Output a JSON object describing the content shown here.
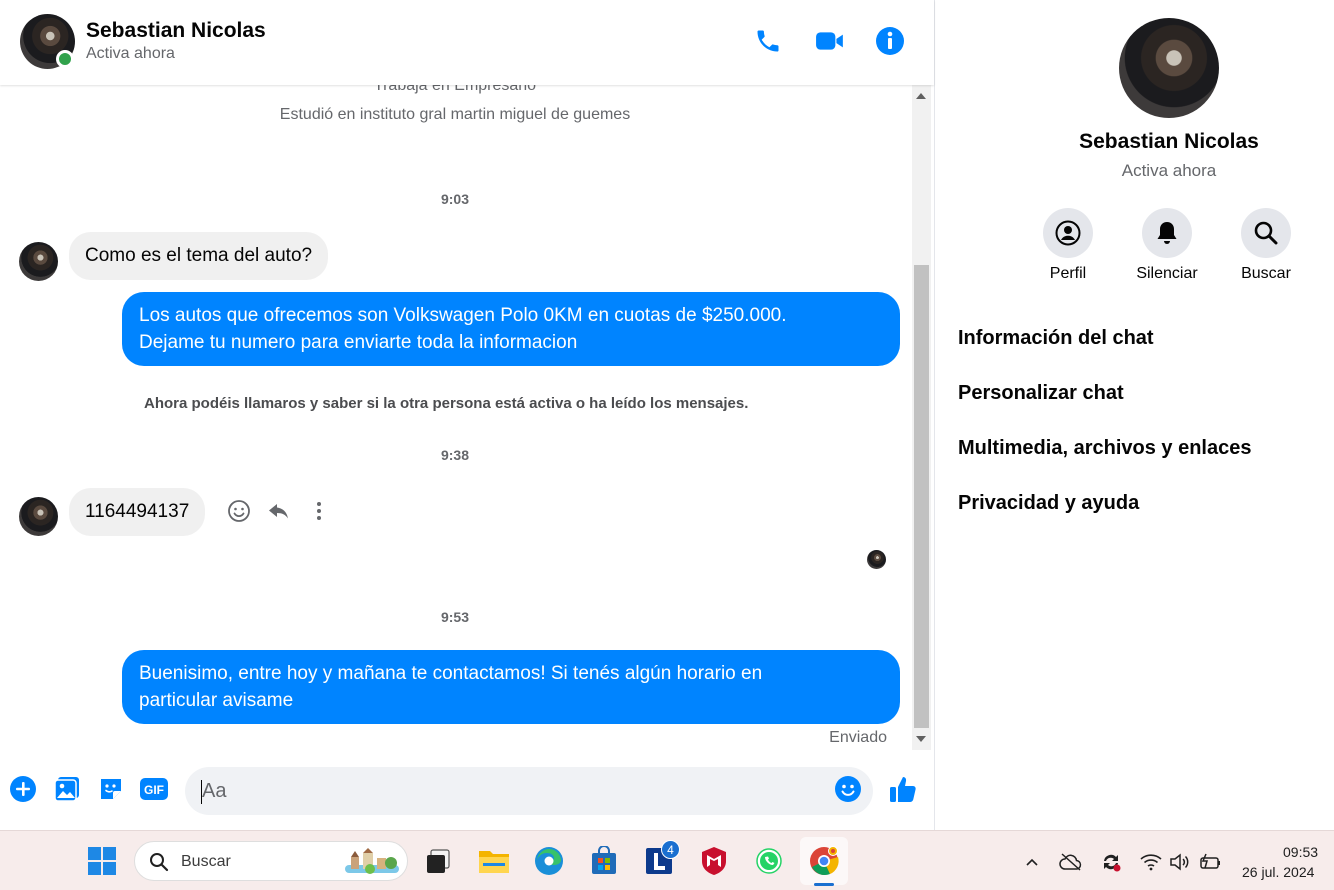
{
  "header": {
    "name": "Sebastian Nicolas",
    "status": "Activa ahora"
  },
  "profile_intro": {
    "work": "Trabaja en Empresario",
    "study": "Estudió en instituto gral martin miguel de guemes"
  },
  "messages": {
    "time_1": "9:03",
    "incoming_1": "Como es el tema del auto?",
    "outgoing_1_line1": "Los autos que ofrecemos son Volkswagen Polo 0KM en cuotas de $250.000.",
    "outgoing_1_line2": "Dejame tu numero para enviarte toda la informacion",
    "notice": "Ahora podéis llamaros y saber si la otra persona está activa o ha leído los mensajes.",
    "time_2": "9:38",
    "incoming_2": "1164494137",
    "time_3": "9:53",
    "outgoing_2_line1": "Buenisimo, entre hoy y mañana te contactamos! Si tenés algún horario en",
    "outgoing_2_line2": "particular avisame",
    "sent_status": "Enviado"
  },
  "composer": {
    "placeholder": "Aa",
    "gif_label": "GIF"
  },
  "right_panel": {
    "name": "Sebastian Nicolas",
    "status": "Activa ahora",
    "actions": {
      "profile": "Perfil",
      "mute": "Silenciar",
      "search": "Buscar"
    },
    "menu": [
      "Información del chat",
      "Personalizar chat",
      "Multimedia, archivos y enlaces",
      "Privacidad y ayuda"
    ]
  },
  "taskbar": {
    "search_label": "Buscar",
    "l_app_badge": "4",
    "time": "09:53",
    "date": "26 jul. 2024"
  },
  "colors": {
    "accent": "#0084ff",
    "online": "#31a24c",
    "incoming_bubble": "#f0f0f0"
  }
}
